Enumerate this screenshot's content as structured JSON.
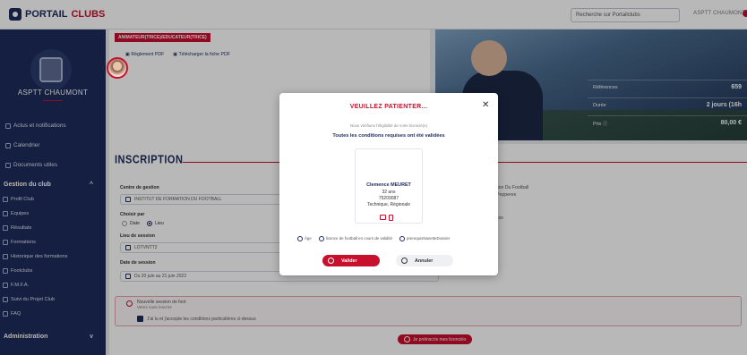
{
  "topbar": {
    "logo": "PORTAIL",
    "logo_accent": "CLUBS",
    "search_placeholder": "Recherche sur Portailclubs",
    "user": "ASPTT CHAUMONT"
  },
  "sidebar": {
    "club_name": "ASPTT CHAUMONT",
    "items": [
      {
        "label": "Actus et notifications",
        "icon": "bell-icon"
      },
      {
        "label": "Calendrier",
        "icon": "calendar-icon"
      },
      {
        "label": "Documents utiles",
        "icon": "document-icon"
      }
    ],
    "section1": "Gestion du club",
    "subitems": [
      "Profil Club",
      "Equipes",
      "Résultats",
      "Formations",
      "Historique des formations",
      "Footclubs",
      "F.M.F.A.",
      "Suivi du Projet Club",
      "FAQ"
    ],
    "section2": "Administration"
  },
  "info": {
    "tag": "ANIMATEUR(TRICE)/EDUCATEUR(TRICE)",
    "link1": "Règlement PDF",
    "link2": "Télécharger la fiche PDF"
  },
  "hero": {
    "rows": [
      {
        "label": "Références",
        "value": "659"
      },
      {
        "label": "Durée",
        "value": "2 jours (16h"
      },
      {
        "label": "Prix ⓘ",
        "value": "80,00 €"
      }
    ]
  },
  "form": {
    "title": "INSCRIPTION",
    "centre_label": "Centre de gestion",
    "centre_value": "INSTITUT DE FORMATION DU FOOTBALL",
    "choisir_label": "Choisir par",
    "radio_date": "Date",
    "radio_lieu": "Lieu",
    "lieu_label": "Lieu de session",
    "lieu_value": "LOTVNTT2",
    "date_label": "Date de session",
    "date_value": "Du 20 juin au 21 juin 2022",
    "right1": "tion Du Football",
    "right2": "Pepperes",
    "right3": "ibis",
    "alert_t1": "Nouvelle session de foot",
    "alert_t2": "Verez vous inscrire",
    "check_label": "J'ai lu et j'accepte les conditions particulières ci-dessus",
    "submit": "Je préinscris mes licenciés"
  },
  "modal": {
    "title": "VEUILLEZ PATIENTER...",
    "checking": "Nous vérifions l'éligibilité de votre licencié(e)",
    "ok": "Toutes les conditions requises ont été validées",
    "person_name": "Clemence MEURET",
    "age": "32 ans",
    "id": "75209087",
    "role": "Technique, Régionale",
    "conds": [
      "Âge",
      "licence de football en cours de validité",
      "prerequisNavetteDossier"
    ],
    "valider": "Valider",
    "annuler": "Annuler"
  },
  "colors": {
    "navy": "#1c2b5a",
    "red": "#c8102e"
  }
}
